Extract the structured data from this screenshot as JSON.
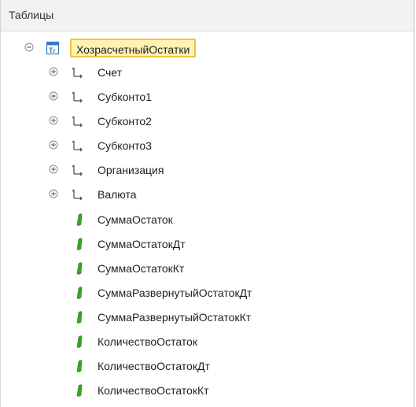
{
  "header": {
    "title": "Таблицы"
  },
  "tree": {
    "root": {
      "label": "ХозрасчетныйОстатки",
      "icon": "table-icon",
      "expanded": true
    },
    "dimensions": [
      {
        "label": "Счет",
        "icon": "dimension-icon"
      },
      {
        "label": "Субконто1",
        "icon": "dimension-icon"
      },
      {
        "label": "Субконто2",
        "icon": "dimension-icon"
      },
      {
        "label": "Субконто3",
        "icon": "dimension-icon"
      },
      {
        "label": "Организация",
        "icon": "dimension-icon"
      },
      {
        "label": "Валюта",
        "icon": "dimension-icon"
      }
    ],
    "resources": [
      {
        "label": "СуммаОстаток",
        "icon": "resource-icon"
      },
      {
        "label": "СуммаОстатокДт",
        "icon": "resource-icon"
      },
      {
        "label": "СуммаОстатокКт",
        "icon": "resource-icon"
      },
      {
        "label": "СуммаРазвернутыйОстатокДт",
        "icon": "resource-icon"
      },
      {
        "label": "СуммаРазвернутыйОстатокКт",
        "icon": "resource-icon"
      },
      {
        "label": "КоличествоОстаток",
        "icon": "resource-icon"
      },
      {
        "label": "КоличествоОстатокДт",
        "icon": "resource-icon"
      },
      {
        "label": "КоличествоОстатокКт",
        "icon": "resource-icon"
      }
    ]
  },
  "colors": {
    "selection_fill": "#fff2b3",
    "selection_border": "#f2c43c",
    "resource_green": "#3aa324",
    "table_icon_blue": "#3a78c2"
  }
}
